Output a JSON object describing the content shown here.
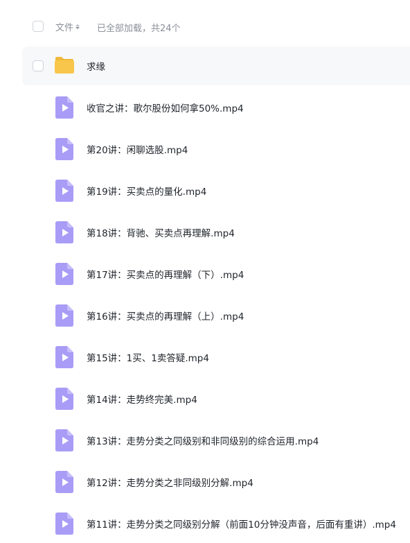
{
  "header": {
    "sort_label": "文件",
    "status_text": "已全部加载，共24个"
  },
  "folder": {
    "name": "求缘"
  },
  "files": [
    {
      "name": "收官之讲：歌尔股份如何拿50%.mp4"
    },
    {
      "name": "第20讲：闲聊选股.mp4"
    },
    {
      "name": "第19讲：买卖点的量化.mp4"
    },
    {
      "name": "第18讲：背驰、买卖点再理解.mp4"
    },
    {
      "name": "第17讲：买卖点的再理解（下）.mp4"
    },
    {
      "name": "第16讲：买卖点的再理解（上）.mp4"
    },
    {
      "name": "第15讲：1买、1卖答疑.mp4"
    },
    {
      "name": "第14讲：走势终完美.mp4"
    },
    {
      "name": "第13讲：走势分类之同级别和非同级别的综合运用.mp4"
    },
    {
      "name": "第12讲：走势分类之非同级别分解.mp4"
    },
    {
      "name": "第11讲：走势分类之同级别分解（前面10分钟没声音，后面有重讲）.mp4"
    }
  ],
  "colors": {
    "folder": "#f8c64a",
    "video_icon": "#a99cf6",
    "text": "#1f2329",
    "muted": "#8a8f99"
  }
}
